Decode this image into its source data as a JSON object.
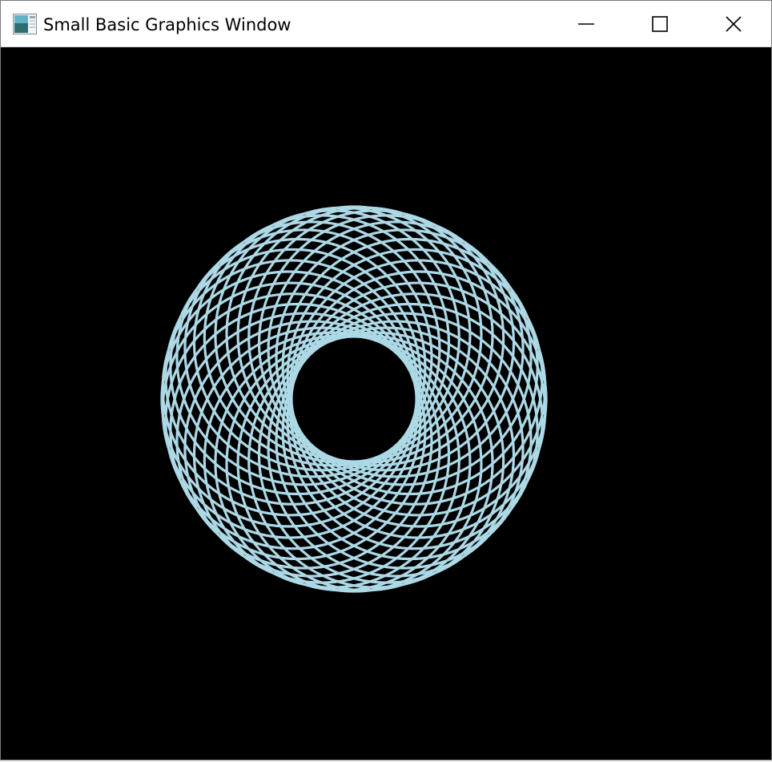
{
  "window": {
    "title": "Small Basic Graphics Window",
    "controls": {
      "minimize_icon": "minimize-icon",
      "maximize_icon": "maximize-icon",
      "close_icon": "close-icon"
    }
  },
  "canvas": {
    "background_color": "#000000",
    "pattern": {
      "stroke_color": "#add8e6",
      "circle_count": 36
    }
  }
}
